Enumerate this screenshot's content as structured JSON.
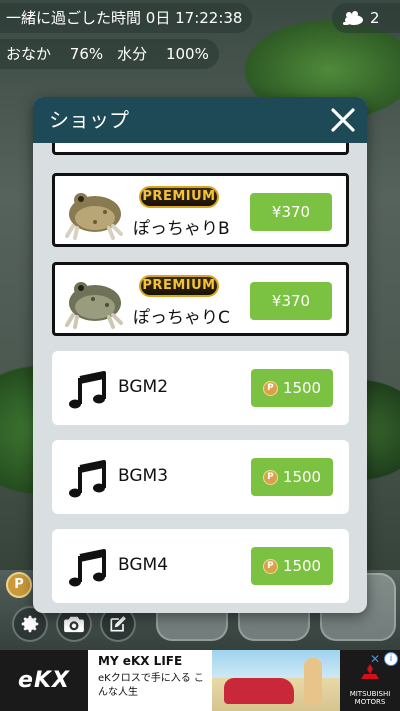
{
  "status": {
    "time_label": "一緒に過ごした時間",
    "time_value": "0日 17:22:38",
    "hunger_label": "おなか",
    "hunger_value": "76%",
    "water_label": "水分",
    "water_value": "100%",
    "frog_count": "2"
  },
  "shop": {
    "title": "ショップ",
    "items": [
      {
        "type": "premium",
        "badge": "PREMIUM",
        "name": "ぽっちゃりB",
        "price": "¥370"
      },
      {
        "type": "premium",
        "badge": "PREMIUM",
        "name": "ぽっちゃりC",
        "price": "¥370"
      },
      {
        "type": "bgm",
        "name": "BGM2",
        "price": "1500",
        "currency": "P"
      },
      {
        "type": "bgm",
        "name": "BGM3",
        "price": "1500",
        "currency": "P"
      },
      {
        "type": "bgm",
        "name": "BGM4",
        "price": "1500",
        "currency": "P"
      }
    ]
  },
  "hud": {
    "coin_symbol": "P"
  },
  "ad": {
    "brand_left": "eKX",
    "headline": "MY eKX LIFE",
    "sub": "eKクロスで手に入る こんな人生",
    "brand_right": "MITSUBISHI MOTORS"
  },
  "colors": {
    "header": "#1e4a57",
    "price_button": "#7cc242",
    "premium_gold": "#f2c23a"
  }
}
